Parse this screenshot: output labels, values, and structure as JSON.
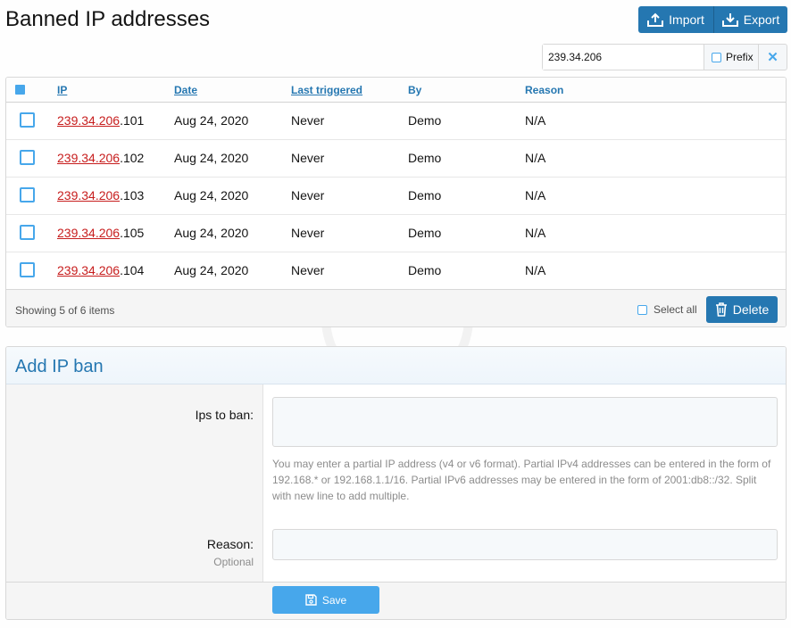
{
  "page": {
    "title": "Banned IP addresses"
  },
  "toolbar": {
    "import_label": "Import",
    "export_label": "Export"
  },
  "filter": {
    "value": "239.34.206",
    "prefix_label": "Prefix",
    "clear_glyph": "✕"
  },
  "table": {
    "headers": {
      "ip": "IP",
      "date": "Date",
      "last_triggered": "Last triggered",
      "by": "By",
      "reason": "Reason"
    },
    "rows": [
      {
        "ip_prefix": "239.34.206",
        "ip_suffix": ".101",
        "date": "Aug 24, 2020",
        "last_triggered": "Never",
        "by": "Demo",
        "reason": "N/A"
      },
      {
        "ip_prefix": "239.34.206",
        "ip_suffix": ".102",
        "date": "Aug 24, 2020",
        "last_triggered": "Never",
        "by": "Demo",
        "reason": "N/A"
      },
      {
        "ip_prefix": "239.34.206",
        "ip_suffix": ".103",
        "date": "Aug 24, 2020",
        "last_triggered": "Never",
        "by": "Demo",
        "reason": "N/A"
      },
      {
        "ip_prefix": "239.34.206",
        "ip_suffix": ".105",
        "date": "Aug 24, 2020",
        "last_triggered": "Never",
        "by": "Demo",
        "reason": "N/A"
      },
      {
        "ip_prefix": "239.34.206",
        "ip_suffix": ".104",
        "date": "Aug 24, 2020",
        "last_triggered": "Never",
        "by": "Demo",
        "reason": "N/A"
      }
    ],
    "footer": {
      "count_text": "Showing 5 of 6 items",
      "select_all_label": "Select all",
      "delete_label": "Delete"
    }
  },
  "form": {
    "title": "Add IP ban",
    "ips_label": "Ips to ban:",
    "ips_hint": "You may enter a partial IP address (v4 or v6 format). Partial IPv4 addresses can be entered in the form of 192.168.* or 192.168.1.1/16. Partial IPv6 addresses may be entered in the form of 2001:db8::/32. Split with new line to add multiple.",
    "reason_label": "Reason:",
    "reason_sublabel": "Optional",
    "save_label": "Save"
  },
  "colors": {
    "accent": "#2577b1",
    "accent_light": "#47a7eb",
    "link_red": "#c71d1d"
  },
  "icons": {
    "import": "upload-icon",
    "export": "download-icon",
    "delete": "trash-icon",
    "save": "floppy-icon"
  }
}
